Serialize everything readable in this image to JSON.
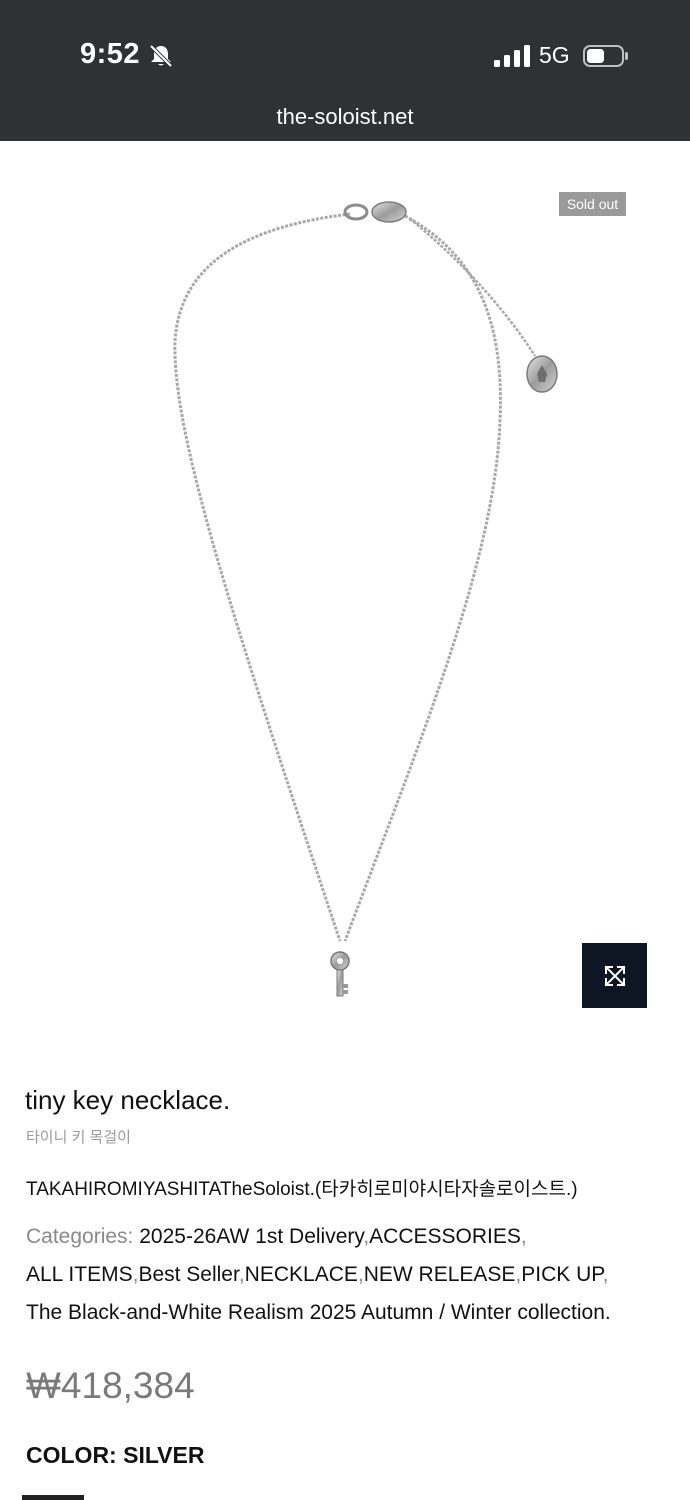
{
  "status_bar": {
    "time": "9:52",
    "network": "5G",
    "url": "the-soloist.net",
    "icons": [
      "bell-muted-icon",
      "signal-icon",
      "battery-icon"
    ]
  },
  "product": {
    "badge": "Sold out",
    "title": "tiny key necklace.",
    "subtitle": "타이니 키 목걸이",
    "brand": "TAKAHIROMIYASHITATheSoloist.(타카히로미야시타자솔로이스트.)",
    "categories_label": "Categories: ",
    "categories": [
      "2025-26AW 1st Delivery",
      "ACCESSORIES",
      "ALL ITEMS",
      "Best Seller",
      "NECKLACE",
      "NEW RELEASE",
      "PICK UP",
      "The Black-and-White Realism 2025 Autumn / Winter collection."
    ],
    "price": "₩418,384",
    "color_label": "COLOR: SILVER"
  },
  "colors": {
    "status_bar_bg": "#2f3133",
    "badge_bg": "#9a9a9a",
    "expand_button_bg": "#0d1622",
    "muted_text": "#8a8a8a"
  }
}
